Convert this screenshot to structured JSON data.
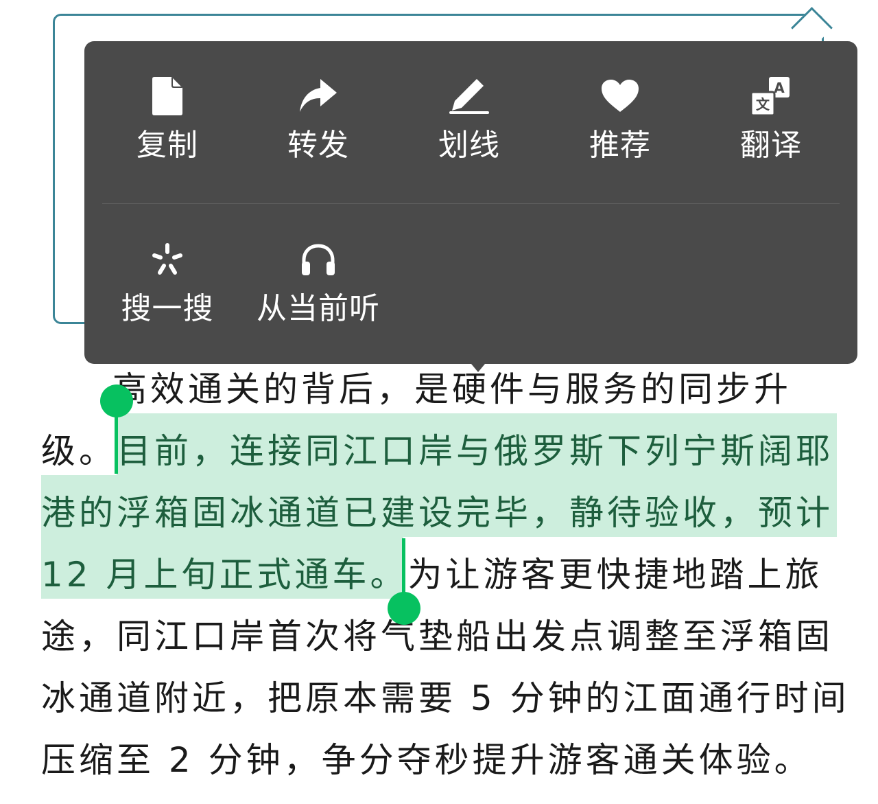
{
  "menu": {
    "row1": [
      {
        "label": "复制",
        "icon": "document-icon"
      },
      {
        "label": "转发",
        "icon": "share-arrow-icon"
      },
      {
        "label": "划线",
        "icon": "pen-underline-icon"
      },
      {
        "label": "推荐",
        "icon": "heart-icon"
      },
      {
        "label": "翻译",
        "icon": "translate-icon"
      }
    ],
    "row2": [
      {
        "label": "搜一搜",
        "icon": "search-sparkle-icon"
      },
      {
        "label": "从当前听",
        "icon": "headphones-icon"
      }
    ],
    "background": "#4a4a4a"
  },
  "article": {
    "line1": "高效通关的背后，是硬件与服务的同步升",
    "line2_plain": "级。",
    "line2_selected": "目前，连接同江口岸与俄罗斯下列宁斯阔耶",
    "line3_selected": "港的浮箱固冰通道已建设完毕，静待验收，预计",
    "line4_selected": "12 月上旬正式通车。",
    "line4_plain": "为让游客更快捷地踏上旅",
    "line5": "途，同江口岸首次将气垫船出发点调整至浮箱固",
    "line6": "冰通道附近，把原本需要 5 分钟的江面通行时间",
    "line7": "压缩至 2 分钟，争分夺秒提升游客通关体验。"
  },
  "colors": {
    "selection": "#cdeedd",
    "handle": "#07c160",
    "card_border": "#3b8597"
  }
}
